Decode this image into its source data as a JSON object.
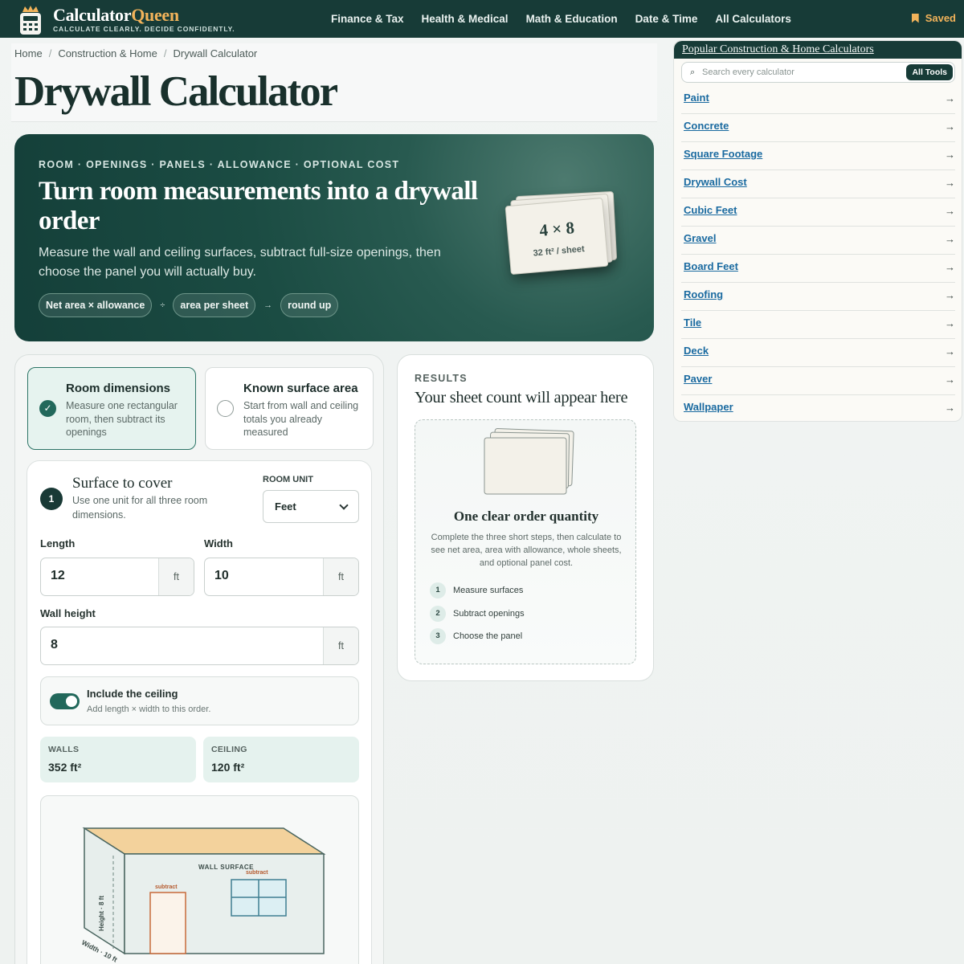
{
  "header": {
    "brand_main": "Calculator",
    "brand_accent": "Queen",
    "tagline": "CALCULATE CLEARLY. DECIDE CONFIDENTLY.",
    "nav": [
      "Finance & Tax",
      "Health & Medical",
      "Math & Education",
      "Date & Time",
      "All Calculators"
    ],
    "saved": "Saved"
  },
  "breadcrumb": [
    "Home",
    "Construction & Home",
    "Drywall Calculator"
  ],
  "page_title": "Drywall Calculator",
  "hero": {
    "kicker": "ROOM · OPENINGS · PANELS · ALLOWANCE · OPTIONAL COST",
    "title": "Turn room measurements into a drywall order",
    "description": "Measure the wall and ceiling surfaces, subtract full-size openings, then choose the panel you will actually buy.",
    "formula": [
      "Net area × allowance",
      "÷",
      "area per sheet",
      "→",
      "round up"
    ],
    "sheet_size": "4 × 8",
    "sheet_area": "32 ft² / sheet"
  },
  "modes": [
    {
      "title": "Room dimensions",
      "description": "Measure one rectangular room, then subtract its openings",
      "selected": true
    },
    {
      "title": "Known surface area",
      "description": "Start from wall and ceiling totals you already measured",
      "selected": false
    }
  ],
  "step1": {
    "number": "1",
    "title": "Surface to cover",
    "description": "Use one unit for all three room dimensions.",
    "unit_label": "ROOM UNIT",
    "unit_value": "Feet",
    "length_label": "Length",
    "length_value": "12",
    "width_label": "Width",
    "width_value": "10",
    "height_label": "Wall height",
    "height_value": "8",
    "unit_suffix": "ft",
    "ceiling_toggle_title": "Include the ceiling",
    "ceiling_toggle_desc": "Add length × width to this order.",
    "ceiling_enabled": true,
    "walls_label": "WALLS",
    "walls_value": "352 ft²",
    "ceiling_label": "CEILING",
    "ceiling_value": "120 ft²"
  },
  "diagram": {
    "wall_surface": "WALL SURFACE",
    "subtract": "subtract",
    "height_label": "Height · 8 ft",
    "width_label": "Width · 10 ft"
  },
  "results": {
    "kicker": "RESULTS",
    "title": "Your sheet count will appear here",
    "empty_title": "One clear order quantity",
    "empty_desc": "Complete the three short steps, then calculate to see net area, area with allowance, whole sheets, and optional panel cost.",
    "steps": [
      "Measure surfaces",
      "Subtract openings",
      "Choose the panel"
    ]
  },
  "sidebar": {
    "title": "Popular Construction & Home Calculators",
    "search_placeholder": "Search every calculator",
    "all_tools": "All Tools",
    "items": [
      "Paint",
      "Concrete",
      "Square Footage",
      "Drywall Cost",
      "Cubic Feet",
      "Gravel",
      "Board Feet",
      "Roofing",
      "Tile",
      "Deck",
      "Paver",
      "Wallpaper"
    ]
  },
  "colors": {
    "header_bg": "#173b37",
    "accent_gold": "#f2b35a",
    "hero_bg": "#1b4c43",
    "link_blue": "#1a6aa0",
    "toggle_on": "#22685b"
  }
}
